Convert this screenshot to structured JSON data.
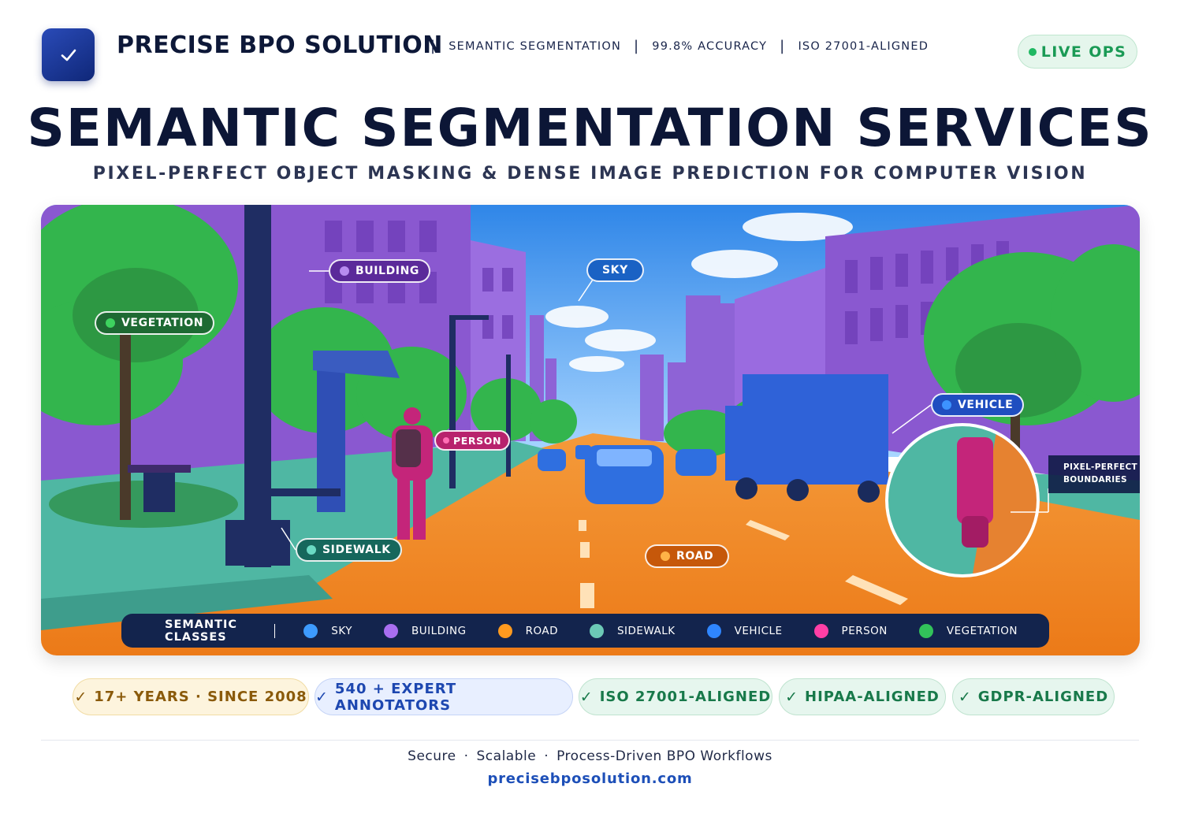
{
  "header": {
    "brand": "PRECISE BPO SOLUTION",
    "meta": [
      "SEMANTIC SEGMENTATION",
      "99.8% ACCURACY",
      "ISO 27001-ALIGNED"
    ],
    "live_label": "LIVE OPS"
  },
  "hero": {
    "title": "SEMANTIC SEGMENTATION SERVICES",
    "subtitle": "PIXEL-PERFECT OBJECT MASKING & DENSE IMAGE PREDICTION FOR COMPUTER VISION"
  },
  "scene": {
    "tags": {
      "building": "BUILDING",
      "vegetation": "VEGETATION",
      "sky": "SKY",
      "person": "PERSON",
      "sidewalk": "SIDEWALK",
      "road": "ROAD",
      "vehicle": "VEHICLE"
    },
    "callout_line1": "PIXEL-PERFECT",
    "callout_line2": "BOUNDARIES"
  },
  "legend": {
    "title": "SEMANTIC CLASSES",
    "items": [
      {
        "label": "SKY",
        "color": "#3d9bff"
      },
      {
        "label": "BUILDING",
        "color": "#a86ef0"
      },
      {
        "label": "ROAD",
        "color": "#ff9a1f"
      },
      {
        "label": "SIDEWALK",
        "color": "#6cc9b6"
      },
      {
        "label": "VEHICLE",
        "color": "#2f86ff"
      },
      {
        "label": "PERSON",
        "color": "#ff3fa6"
      },
      {
        "label": "VEGETATION",
        "color": "#32c25a"
      }
    ]
  },
  "badges": [
    "17+ YEARS · SINCE 2008",
    "540 + EXPERT ANNOTATORS",
    "ISO 27001-ALIGNED",
    "HIPAA-ALIGNED",
    "GDPR-ALIGNED"
  ],
  "footer": {
    "items": [
      "Secure",
      "Scalable",
      "Process-Driven BPO Workflows"
    ],
    "url": "precisebposolution.com"
  }
}
